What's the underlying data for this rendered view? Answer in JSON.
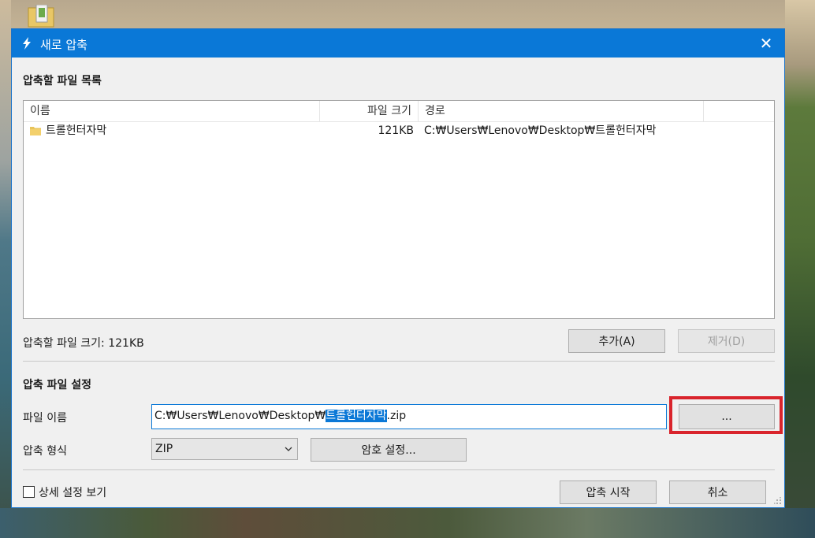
{
  "window": {
    "title": "새로 압축",
    "close_glyph": "✕"
  },
  "file_list": {
    "section_title": "압축할 파일 목록",
    "columns": [
      "이름",
      "파일 크기",
      "경로"
    ],
    "rows": [
      {
        "name": "트롤헌터자막",
        "size": "121KB",
        "path": "C:₩Users₩Lenovo₩Desktop₩트롤헌터자막"
      }
    ],
    "total_size_label": "압축할 파일 크기: 121KB",
    "add_button": "추가(A)",
    "remove_button": "제거(D)"
  },
  "settings": {
    "section_title": "압축 파일 설정",
    "filename_label": "파일 이름",
    "filename_prefix": "C:₩Users₩Lenovo₩Desktop₩",
    "filename_selected": "트롤헌터자막",
    "filename_suffix": ".zip",
    "browse_button": "...",
    "format_label": "압축 형식",
    "format_value": "ZIP",
    "password_button": "암호 설정..."
  },
  "footer": {
    "details_checkbox_label": "상세 설정 보기",
    "details_checked": false,
    "start_button": "압축 시작",
    "cancel_button": "취소"
  },
  "colors": {
    "titlebar": "#0a78d7",
    "highlight_box": "#d9242c",
    "folder": "#e8c45a"
  },
  "icons": {
    "app": "lightning-icon",
    "folder": "folder-icon",
    "dropdown": "chevron-down-icon"
  }
}
